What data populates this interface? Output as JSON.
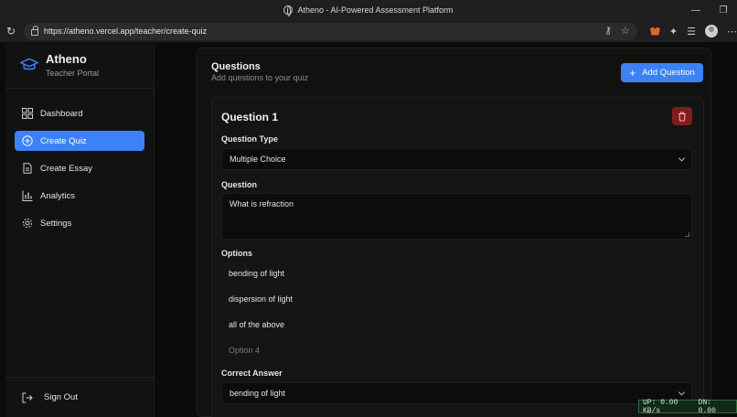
{
  "browser": {
    "window_title": "Atheno - AI-Powered Assessment Platform",
    "url": "https://atheno.vercel.app/teacher/create-quiz"
  },
  "brand": {
    "name": "Atheno",
    "subtitle": "Teacher Portal"
  },
  "sidebar": {
    "items": [
      {
        "label": "Dashboard",
        "icon": "dashboard-icon",
        "active": false
      },
      {
        "label": "Create Quiz",
        "icon": "plus-circle-icon",
        "active": true
      },
      {
        "label": "Create Essay",
        "icon": "document-icon",
        "active": false
      },
      {
        "label": "Analytics",
        "icon": "bar-chart-icon",
        "active": false
      },
      {
        "label": "Settings",
        "icon": "gear-icon",
        "active": false
      }
    ],
    "signout_label": "Sign Out"
  },
  "questions": {
    "title": "Questions",
    "subtitle": "Add questions to your quiz",
    "add_button": "Add Question"
  },
  "question": {
    "title": "Question 1",
    "type_label": "Question Type",
    "type_value": "Multiple Choice",
    "question_label": "Question",
    "question_value": "What is refraction",
    "options_label": "Options",
    "options": [
      "bending of light",
      "dispersion of light",
      "all of the above"
    ],
    "option4_placeholder": "Option 4",
    "correct_label": "Correct Answer",
    "correct_value": "bending of light"
  },
  "netmeter": {
    "up": "UP: 0.00 KB/s",
    "down": "DN: 0.00"
  },
  "colors": {
    "accent": "#3b82f6",
    "danger": "#7f1d1d",
    "background": "#0b0b0b"
  }
}
